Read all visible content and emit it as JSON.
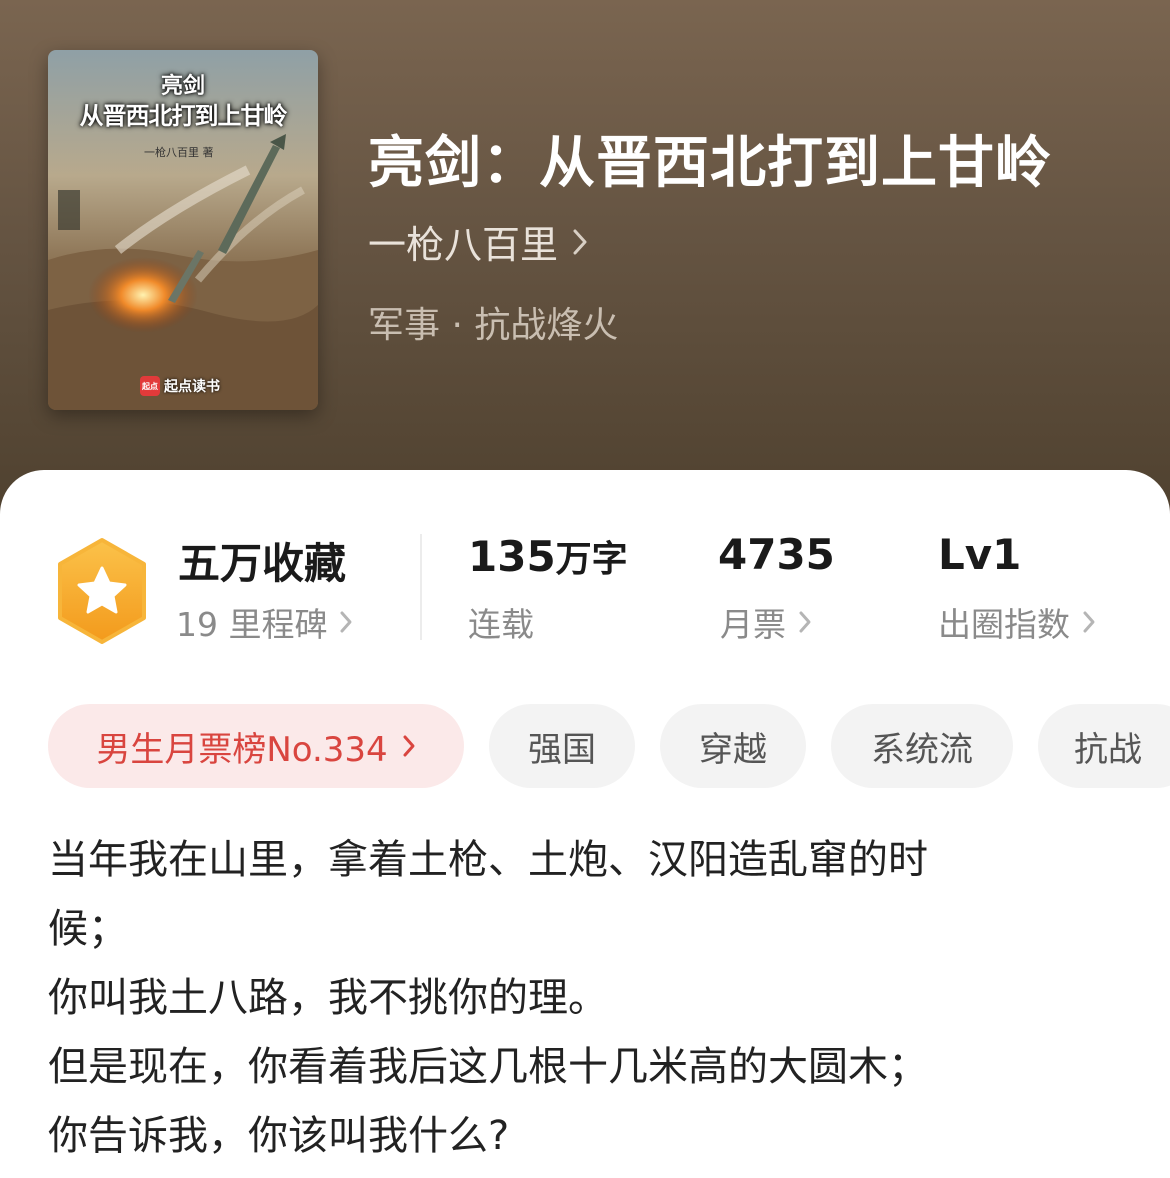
{
  "header": {
    "cover": {
      "title_line1": "亮剑",
      "title_line2": "从晋西北打到上甘岭",
      "author": "一枪八百里 著",
      "brand_badge": "起点",
      "brand": "起点读书"
    },
    "title": "亮剑：从晋西北打到上甘岭",
    "author": "一枪八百里",
    "genre": "军事 · 抗战烽火"
  },
  "stats": {
    "collect": {
      "main": "五万收藏",
      "sub": "19 里程碑"
    },
    "words": {
      "number": "135",
      "unit": "万字",
      "sub": "连载"
    },
    "tickets": {
      "main": "4735",
      "sub": "月票"
    },
    "level": {
      "main": "Lv1",
      "sub": "出圈指数"
    }
  },
  "tags": {
    "rank": "男生月票榜No.334",
    "items": [
      "强国",
      "穿越",
      "系统流",
      "抗战"
    ]
  },
  "synopsis": [
    "当年我在山里，拿着土枪、土炮、汉阳造乱窜的时",
    "候；",
    "你叫我土八路，我不挑你的理。",
    "但是现在，你看着我后这几根十几米高的大圆木；",
    "你告诉我，你该叫我什么?"
  ],
  "colors": {
    "header_bg": "#6b5846",
    "rank_tag_bg": "#fbe9e9",
    "rank_tag_text": "#d9453f",
    "medal": "#f5a623"
  }
}
